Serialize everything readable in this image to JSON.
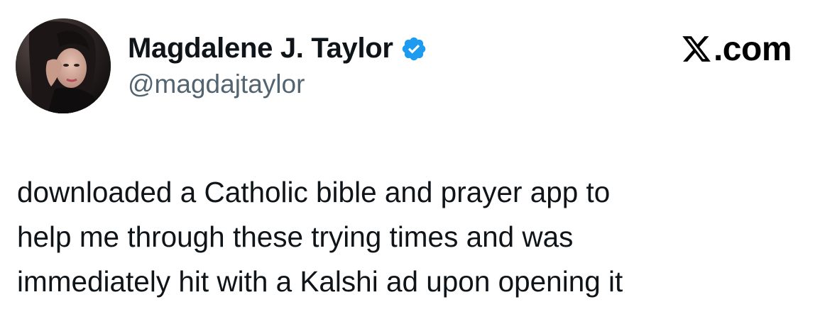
{
  "author": {
    "display_name": "Magdalene J. Taylor",
    "handle": "@magdajtaylor",
    "verified": true,
    "verified_badge_icon": "verified-badge-icon",
    "avatar_icon": "profile-photo"
  },
  "brand": {
    "logo_icon": "x-logo-icon",
    "label": ".com"
  },
  "tweet": {
    "lines": [
      "downloaded a Catholic bible and prayer app to",
      "help me through these trying times and was",
      "immediately hit with a Kalshi ad upon opening it"
    ]
  },
  "colors": {
    "text": "#0f1419",
    "secondary_text": "#536471",
    "verified_blue": "#1d9bf0",
    "background": "#ffffff"
  }
}
